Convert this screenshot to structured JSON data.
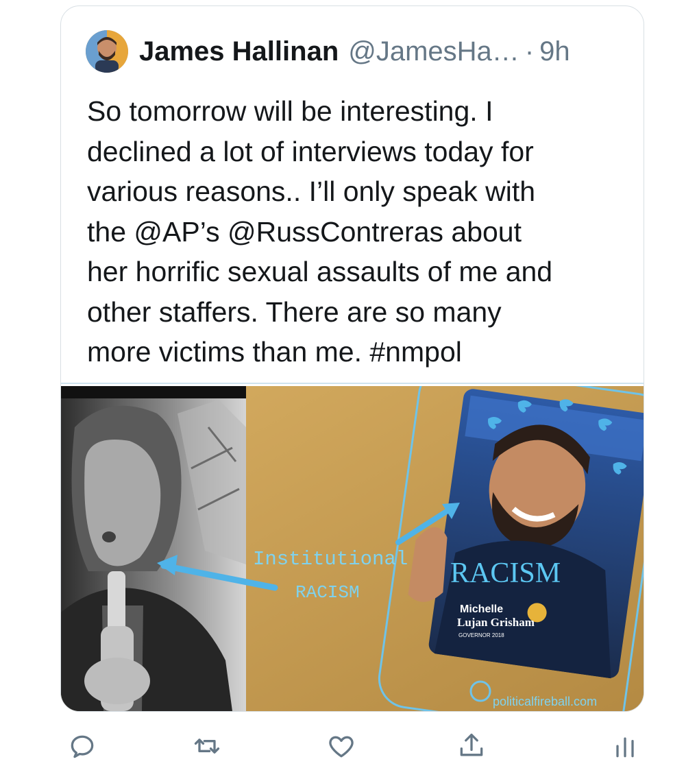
{
  "tweet": {
    "author_name": "James Hallinan",
    "author_handle": "@JamesHa…",
    "separator": "·",
    "time": "9h",
    "text": "So tomorrow will be interesting. I\ndeclined a lot of interviews today for\nvarious reasons.. I’ll only speak with\nthe @AP’s @RussContreras about\nher horrific sexual assaults of me and\nother staffers. There are so many\nmore victims than me. #nmpol"
  },
  "media": {
    "overlay_left_line1": "Institutional",
    "overlay_left_line2": "RACISM",
    "overlay_right": "RACISM",
    "shirt_line1": "Michelle",
    "shirt_line2": "Lujan Grisham",
    "shirt_line3": "GOVERNOR 2018",
    "watermark": "politicalfireball.com"
  },
  "actions": {
    "reply_icon": "reply-icon",
    "retweet_icon": "retweet-icon",
    "like_icon": "heart-icon",
    "share_icon": "share-icon",
    "analytics_icon": "analytics-icon"
  },
  "colors": {
    "accent_arrow": "#4fb3e8",
    "text_primary": "#14171a",
    "text_secondary": "#657786",
    "border": "#d8dfe4"
  }
}
